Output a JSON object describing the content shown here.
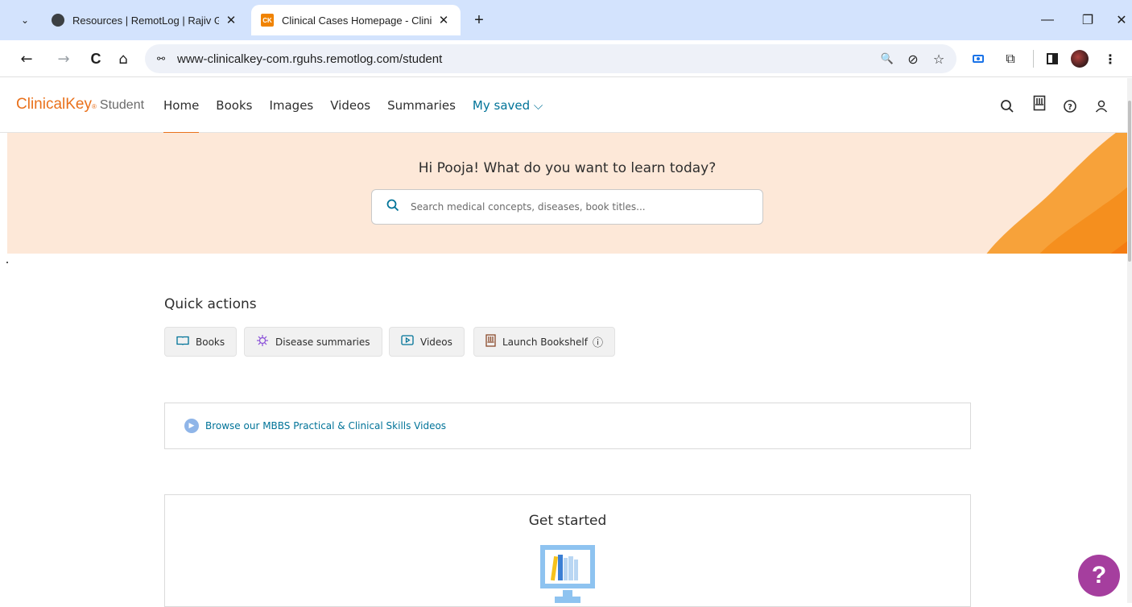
{
  "browser": {
    "tabs": [
      {
        "title": "Resources | RemotLog | Rajiv Ga",
        "close": "✕",
        "icon": "globe-icon"
      },
      {
        "title": "Clinical Cases Homepage - Clini",
        "close": "✕",
        "icon": "clinicalkey-favicon",
        "favicon_text": "CK"
      }
    ],
    "new_tab": "+",
    "tab_menu": "⌄",
    "window_controls": {
      "minimize": "—",
      "restore": "❐",
      "close": "✕"
    },
    "nav": {
      "back": "←",
      "forward": "→",
      "reload": "C",
      "home": "⌂"
    },
    "address": {
      "site_info": "⚯",
      "url": "www-clinicalkey-com.rguhs.remotlog.com/student"
    },
    "omni_icons": {
      "zoom": "🔍",
      "eye_off": "⊘",
      "bookmark_star": "☆"
    },
    "toolbar": {
      "extensions": "⧉",
      "menu": "⋮"
    }
  },
  "site": {
    "logo": {
      "brand": "ClinicalKey",
      "reg": "®",
      "product": "Student"
    },
    "nav": [
      {
        "label": "Home",
        "active": true
      },
      {
        "label": "Books"
      },
      {
        "label": "Images"
      },
      {
        "label": "Videos"
      },
      {
        "label": "Summaries"
      },
      {
        "label": "My saved ⌵"
      }
    ],
    "header_icons": [
      "search-icon",
      "bookshelf-icon",
      "help-icon",
      "account-icon"
    ]
  },
  "hero": {
    "greeting": "Hi Pooja! What do you want to learn today?",
    "search_placeholder": "Search medical concepts, diseases, book titles..."
  },
  "quick_actions": {
    "title": "Quick actions",
    "buttons": [
      {
        "label": "Books",
        "icon": "book-icon"
      },
      {
        "label": "Disease summaries",
        "icon": "virus-icon"
      },
      {
        "label": "Videos",
        "icon": "video-icon"
      },
      {
        "label": "Launch Bookshelf",
        "icon": "bookshelf-icon",
        "info": "ⓘ"
      }
    ]
  },
  "browse_banner": {
    "text": "Browse our MBBS Practical & Clinical Skills Videos"
  },
  "get_started": {
    "title": "Get started"
  },
  "help_fab": "?",
  "colors": {
    "brand_orange": "#e9711c",
    "link_teal": "#007398",
    "hero_bg": "#fde8d8",
    "help_purple": "#a53e9e",
    "tabbar_bg": "#d3e3fd"
  }
}
